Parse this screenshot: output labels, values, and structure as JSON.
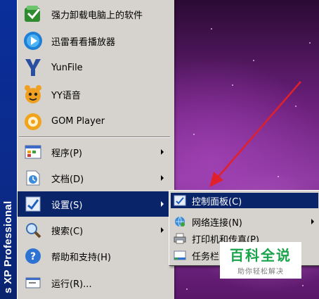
{
  "start_menu": {
    "side_band_text": "s XP Professional",
    "pinned_items": [
      {
        "label": "强力卸载电脑上的软件",
        "icon": "uninstaller-icon"
      },
      {
        "label": "迅雷看看播放器",
        "icon": "xunlei-player-icon"
      },
      {
        "label": "YunFile",
        "icon": "yunfile-icon"
      },
      {
        "label": "YY语音",
        "icon": "yy-voice-icon"
      },
      {
        "label": "GOM Player",
        "icon": "gom-player-icon"
      }
    ],
    "system_items": [
      {
        "label": "程序(P)",
        "icon": "programs-icon",
        "has_submenu": true
      },
      {
        "label": "文档(D)",
        "icon": "documents-icon",
        "has_submenu": true
      },
      {
        "label": "设置(S)",
        "icon": "settings-icon",
        "has_submenu": true,
        "active": true
      },
      {
        "label": "搜索(C)",
        "icon": "search-icon",
        "has_submenu": true
      },
      {
        "label": "帮助和支持(H)",
        "icon": "help-icon",
        "has_submenu": false
      },
      {
        "label": "运行(R)...",
        "icon": "run-icon",
        "has_submenu": false
      }
    ]
  },
  "settings_submenu": {
    "items": [
      {
        "label": "控制面板(C)",
        "icon": "control-panel-icon",
        "has_submenu": false,
        "active": true
      },
      {
        "label": "网络连接(N)",
        "icon": "network-icon",
        "has_submenu": true
      },
      {
        "label": "打印机和传真(P)",
        "icon": "printer-icon",
        "has_submenu": false
      },
      {
        "label": "任务栏",
        "icon": "taskbar-icon",
        "has_submenu": false
      }
    ]
  },
  "watermark": {
    "title": "百科全说",
    "subtitle": "助你轻松解决"
  },
  "colors": {
    "highlight": "#0a246a",
    "menu_bg": "#d6d3ce",
    "side_band": "#0a2a8c",
    "annotation": "#e0202a"
  }
}
